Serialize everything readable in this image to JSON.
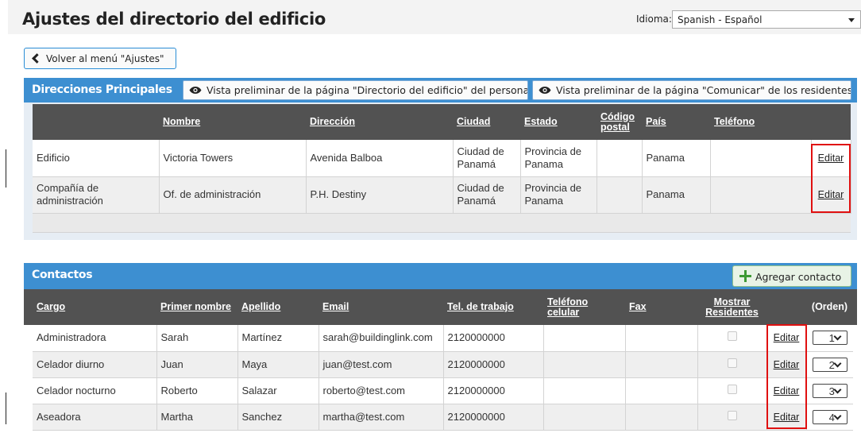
{
  "header": {
    "title": "Ajustes del directorio del edificio",
    "language_label": "Idioma:",
    "language_value": "Spanish - Español"
  },
  "back_button": {
    "label": "Volver al menú \"Ajustes\""
  },
  "principal": {
    "title": "Direcciones Principales",
    "preview_staff": "Vista preliminar de la página \"Directorio del edificio\" del personal",
    "preview_residents": "Vista preliminar de la página \"Comunicar\" de los residentes",
    "columns": [
      "Nombre",
      "Dirección",
      "Ciudad",
      "Estado",
      "Código postal",
      "País",
      "Teléfono"
    ],
    "rows": [
      {
        "type": "Edificio",
        "name": "Victoria Towers",
        "address": "Avenida Balboa",
        "city": "Ciudad de Panamá",
        "state": "Provincia de Panama",
        "zip": "",
        "country": "Panama",
        "phone": "",
        "edit": "Editar"
      },
      {
        "type": "Compañía de administración",
        "name": "Of. de administración",
        "address": "P.H. Destiny",
        "city": "Ciudad de Panamá",
        "state": "Provincia de Panama",
        "zip": "",
        "country": "Panama",
        "phone": "",
        "edit": "Editar"
      }
    ]
  },
  "contacts": {
    "title": "Contactos",
    "add_label": "Agregar contacto",
    "columns": [
      "Cargo",
      "Primer nombre",
      "Apellido",
      "Email",
      "Tel. de trabajo",
      "Teléfono celular",
      "Fax",
      "Mostrar Residentes",
      "",
      "(Orden)"
    ],
    "rows": [
      {
        "role": "Administradora",
        "first": "Sarah",
        "last": "Martínez",
        "email": "sarah@buildinglink.com",
        "work": "2120000000",
        "cell": "",
        "fax": "",
        "edit": "Editar",
        "order": "1"
      },
      {
        "role": "Celador diurno",
        "first": "Juan",
        "last": "Maya",
        "email": "juan@test.com",
        "work": "2120000000",
        "cell": "",
        "fax": "",
        "edit": "Editar",
        "order": "2"
      },
      {
        "role": "Celador nocturno",
        "first": "Roberto",
        "last": "Salazar",
        "email": "roberto@test.com",
        "work": "2120000000",
        "cell": "",
        "fax": "",
        "edit": "Editar",
        "order": "3"
      },
      {
        "role": "Aseadora",
        "first": "Martha",
        "last": "Sanchez",
        "email": "martha@test.com",
        "work": "2120000000",
        "cell": "",
        "fax": "",
        "edit": "Editar",
        "order": "4"
      }
    ]
  },
  "colors": {
    "section_blue": "#3d8fd1",
    "header_gray": "#525252",
    "highlight_red": "#e01010",
    "add_green": "#3d9a34"
  },
  "icons": {
    "back": "chevron-left-icon",
    "preview": "eye-icon",
    "add": "plus-icon",
    "select": "chevron-down-icon"
  }
}
